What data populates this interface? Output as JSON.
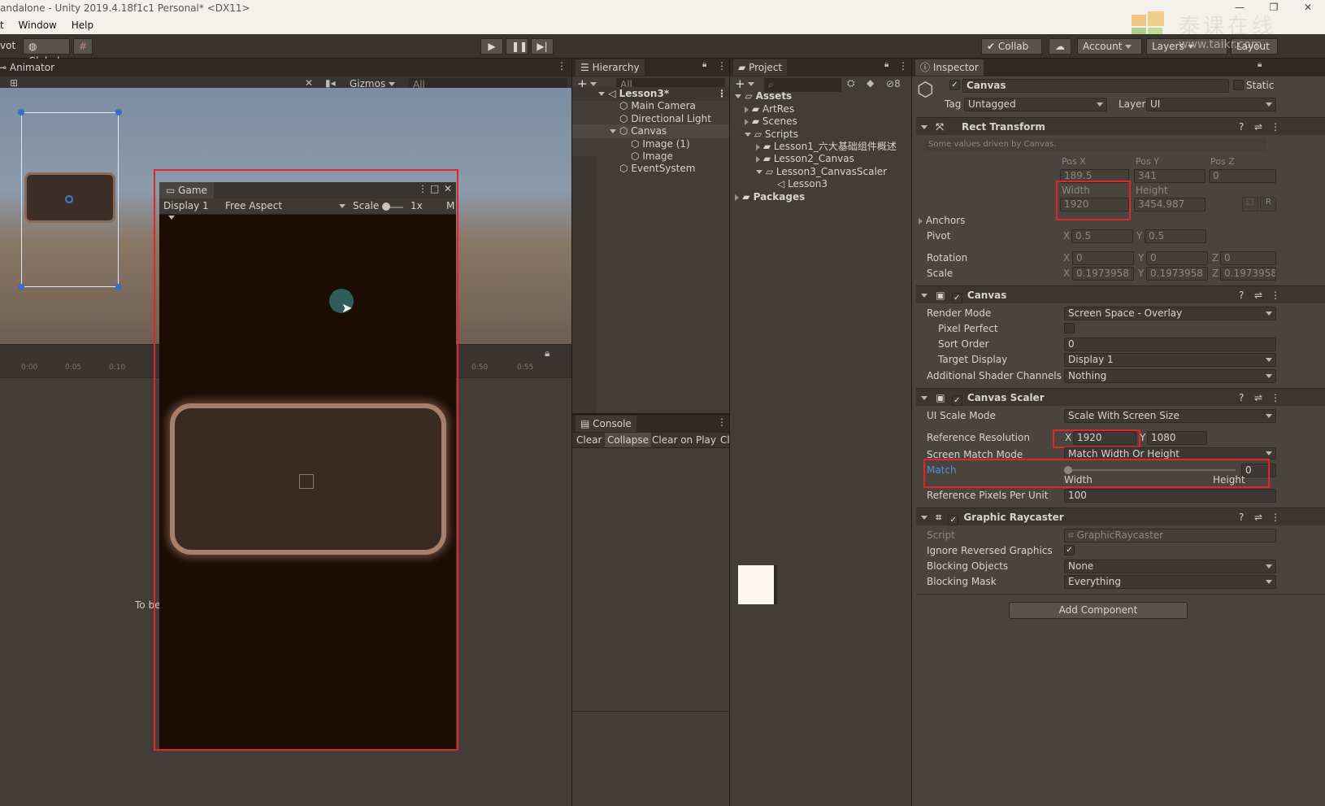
{
  "window": {
    "title": "andalone - Unity 2019.4.18f1c1 Personal* <DX11>",
    "controls": [
      "—",
      "❐",
      "✕"
    ]
  },
  "menu": [
    "t",
    "Window",
    "Help"
  ],
  "toolbar": {
    "pivot": "vot",
    "global": "Global",
    "collab": "Collab",
    "account": "Account",
    "layers": "Layers",
    "layout": "Layout"
  },
  "watermark": {
    "cn": "泰课在线",
    "url": "www.taikr.com"
  },
  "scene": {
    "tab": "Animator",
    "gizmos": "Gizmos",
    "search_placeholder": "All",
    "timeline_ticks": [
      "0:00",
      "0:05",
      "0:10",
      "0:50",
      "0:55"
    ],
    "partial_text": "To be"
  },
  "game": {
    "tab": "Game",
    "display": "Display 1",
    "aspect": "Free Aspect",
    "scale_label": "Scale",
    "scale_value": "1x",
    "more": "M"
  },
  "hierarchy": {
    "tab": "Hierarchy",
    "search_placeholder": "All",
    "scene": "Lesson3*",
    "items": [
      "Main Camera",
      "Directional Light",
      "Canvas",
      "Image (1)",
      "Image",
      "EventSystem"
    ]
  },
  "project": {
    "tab": "Project",
    "hidden_count": "8",
    "tree": {
      "assets": "Assets",
      "artres": "ArtRes",
      "scenes": "Scenes",
      "scripts": "Scripts",
      "lesson1": "Lesson1_六大基础组件概述",
      "lesson2": "Lesson2_Canvas",
      "lesson3": "Lesson3_CanvasScaler",
      "lesson3scene": "Lesson3",
      "packages": "Packages"
    }
  },
  "console": {
    "tab": "Console",
    "buttons": [
      "Clear",
      "Collapse",
      "Clear on Play",
      "Cl"
    ]
  },
  "inspector": {
    "tab": "Inspector",
    "object_name": "Canvas",
    "static": "Static",
    "tag_label": "Tag",
    "tag": "Untagged",
    "layer_label": "Layer",
    "layer": "UI",
    "rect_transform": {
      "title": "Rect Transform",
      "note": "Some values driven by Canvas.",
      "posx_label": "Pos X",
      "posy_label": "Pos Y",
      "posz_label": "Pos Z",
      "posx": "189.5",
      "posy": "341",
      "posz": "0",
      "width_label": "Width",
      "height_label": "Height",
      "width": "1920",
      "height": "3454.987",
      "anchors": "Anchors",
      "pivot": "Pivot",
      "pivot_x": "0.5",
      "pivot_y": "0.5",
      "rotation": "Rotation",
      "rot_x": "0",
      "rot_y": "0",
      "rot_z": "0",
      "scale": "Scale",
      "scale_x": "0.1973958",
      "scale_y": "0.1973958",
      "scale_z": "0.1973958",
      "r_btn": "R"
    },
    "canvas": {
      "title": "Canvas",
      "render_mode_label": "Render Mode",
      "render_mode": "Screen Space - Overlay",
      "pixel_perfect_label": "Pixel Perfect",
      "sort_order_label": "Sort Order",
      "sort_order": "0",
      "target_display_label": "Target Display",
      "target_display": "Display 1",
      "shader_channels_label": "Additional Shader Channels",
      "shader_channels": "Nothing"
    },
    "canvas_scaler": {
      "title": "Canvas Scaler",
      "ui_scale_mode_label": "UI Scale Mode",
      "ui_scale_mode": "Scale With Screen Size",
      "ref_res_label": "Reference Resolution",
      "ref_x": "1920",
      "ref_y": "1080",
      "match_mode_label": "Screen Match Mode",
      "match_mode": "Match Width Or Height",
      "match_label": "Match",
      "match_value": "0",
      "match_fraction": 0,
      "width_label": "Width",
      "height_label": "Height",
      "ppu_label": "Reference Pixels Per Unit",
      "ppu": "100"
    },
    "graphic_raycaster": {
      "title": "Graphic Raycaster",
      "script_label": "Script",
      "script": "GraphicRaycaster",
      "ignore_reversed_label": "Ignore Reversed Graphics",
      "blocking_objects_label": "Blocking Objects",
      "blocking_objects": "None",
      "blocking_mask_label": "Blocking Mask",
      "blocking_mask": "Everything"
    },
    "add_component": "Add Component"
  },
  "colors": {
    "highlight": "#e0252f",
    "accent_link": "#5a8fd8"
  }
}
